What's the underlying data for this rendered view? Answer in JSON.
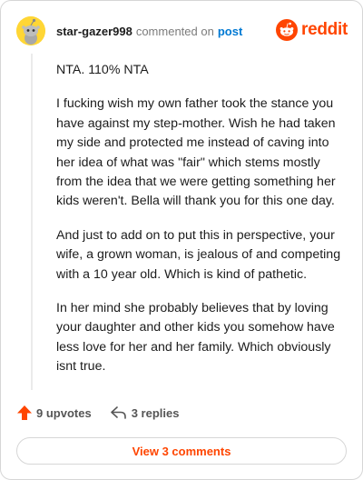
{
  "comment": {
    "username": "star-gazer998",
    "commented_on": "commented on",
    "post_link": "post",
    "paragraphs": [
      "NTA. 110% NTA",
      "I fucking wish my own father took the stance you have against my step-mother. Wish he had taken my side and protected me instead of caving into her idea of what was \"fair\" which stems mostly from the idea that we were getting something her kids weren't. Bella will thank you for this one day.",
      "And just to add on to put this in perspective, your wife, a grown woman, is jealous of and competing with a 10 year old. Which is kind of pathetic.",
      "In her mind she probably believes that by loving your daughter and other kids you somehow have less love for her and her family. Which obviously isnt true."
    ],
    "upvotes": "9 upvotes",
    "replies": "3 replies",
    "view_comments": "View 3 comments"
  },
  "brand": {
    "logo_text": "reddit",
    "logo_icon": "reddit-snoo-icon",
    "accent": "#ff4500",
    "link_color": "#0079d3"
  },
  "icons": {
    "avatar": "snoo-avatar-icon",
    "upvote": "upvote-arrow-icon",
    "reply": "reply-arrow-icon"
  }
}
